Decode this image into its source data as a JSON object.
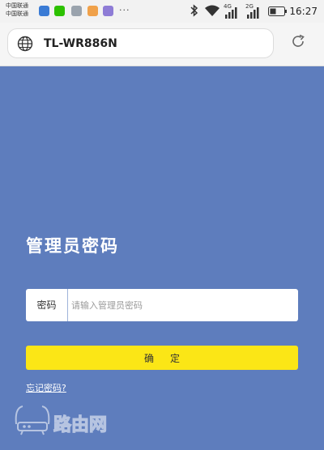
{
  "status_bar": {
    "carrier_1": "中国联通",
    "carrier_2": "中国联通",
    "more": "···",
    "net_1": "4G",
    "net_2": "2G",
    "time": "16:27",
    "notification_icons": [
      "blue-app-icon",
      "wechat-icon",
      "gallery-icon",
      "app-icon",
      "purple-app-icon"
    ],
    "colors": {
      "notif_1": "#3a7bd5",
      "notif_2": "#2dc100",
      "notif_3": "#9aa3ad",
      "notif_4": "#f0a14a",
      "notif_5": "#8e7cd6"
    }
  },
  "browser": {
    "url": "TL-WR886N",
    "icons": [
      "globe-icon",
      "reload-icon"
    ]
  },
  "login": {
    "title": "管理员密码",
    "password_label": "密码",
    "password_placeholder": "请输入管理员密码",
    "password_value": "",
    "confirm_label": "确定",
    "forgot_link": "忘记密码?"
  },
  "watermark": {
    "text": "路由网",
    "icon": "router-icon"
  },
  "colors": {
    "background": "#5e7dbd",
    "button": "#fbe616",
    "text_light": "#ffffff"
  }
}
